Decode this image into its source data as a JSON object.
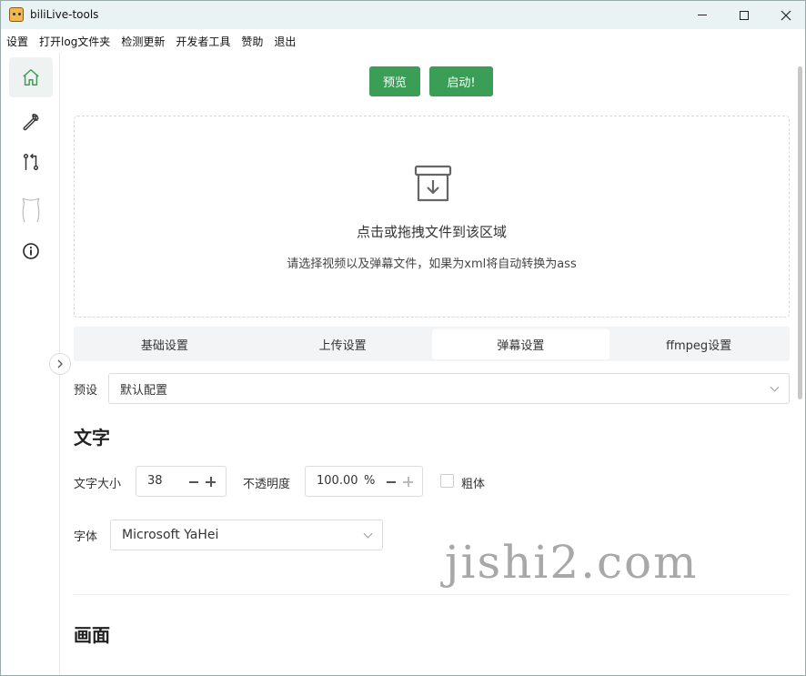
{
  "window": {
    "title": "biliLive-tools"
  },
  "menu": {
    "items": [
      "设置",
      "打开log文件夹",
      "检测更新",
      "开发者工具",
      "赞助",
      "退出"
    ]
  },
  "sidebar": {
    "items": [
      {
        "icon": "home-icon",
        "active": true
      },
      {
        "icon": "wrench-icon",
        "active": false
      },
      {
        "icon": "branch-compare-icon",
        "active": false
      },
      {
        "icon": "mascot-icon",
        "active": false
      },
      {
        "icon": "info-icon",
        "active": false
      }
    ]
  },
  "toolbar": {
    "preview_label": "预览",
    "start_label": "启动!"
  },
  "dropzone": {
    "title": "点击或拖拽文件到该区域",
    "subtitle": "请选择视频以及弹幕文件，如果为xml将自动转换为ass"
  },
  "tabs": [
    {
      "label": "基础设置",
      "active": false
    },
    {
      "label": "上传设置",
      "active": false
    },
    {
      "label": "弹幕设置",
      "active": true
    },
    {
      "label": "ffmpeg设置",
      "active": false
    }
  ],
  "preset": {
    "label": "预设",
    "value": "默认配置"
  },
  "text_section": {
    "title": "文字",
    "size_label": "文字大小",
    "size_value": "38",
    "opacity_label": "不透明度",
    "opacity_value": "100.00",
    "opacity_unit": "%",
    "bold_label": "粗体",
    "bold_checked": false,
    "font_label": "字体",
    "font_value": "Microsoft YaHei"
  },
  "picture_section": {
    "title": "画面"
  },
  "watermark": "jishi2.com",
  "colors": {
    "primary": "#3a9e57",
    "titlebar": "#eaf3f4",
    "accent_icon": "#3a9e57"
  }
}
